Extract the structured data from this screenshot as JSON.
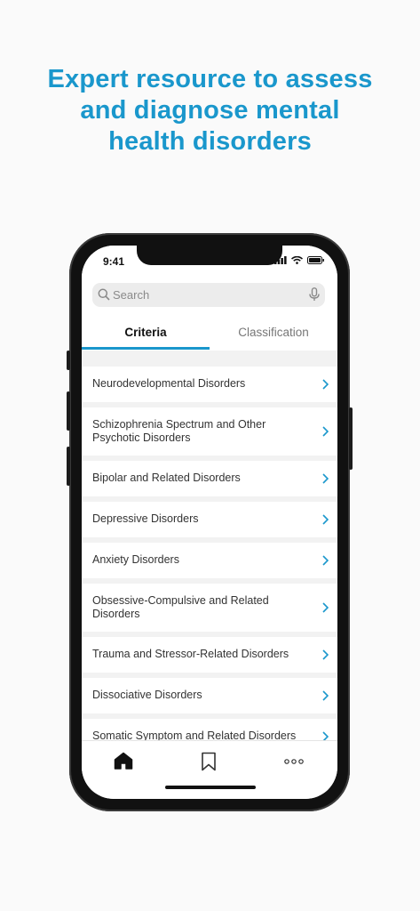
{
  "headline": {
    "line1": "Expert resource to assess",
    "line2": "and diagnose mental",
    "line3": "health disorders"
  },
  "status_bar": {
    "time": "9:41"
  },
  "search": {
    "placeholder": "Search"
  },
  "tabs": [
    {
      "label": "Criteria",
      "active": true
    },
    {
      "label": "Classification",
      "active": false
    }
  ],
  "disorders": [
    {
      "label": "Neurodevelopmental Disorders"
    },
    {
      "label": "Schizophrenia Spectrum and Other Psychotic Disorders"
    },
    {
      "label": "Bipolar and Related Disorders"
    },
    {
      "label": "Depressive Disorders"
    },
    {
      "label": "Anxiety Disorders"
    },
    {
      "label": "Obsessive-Compulsive and Related Disorders"
    },
    {
      "label": "Trauma and Stressor-Related Disorders"
    },
    {
      "label": "Dissociative Disorders"
    },
    {
      "label": "Somatic Symptom and Related Disorders"
    }
  ],
  "tabbar": {
    "items": [
      "home-icon",
      "bookmark-icon",
      "more-icon"
    ]
  },
  "colors": {
    "accent": "#1a97cc",
    "text": "#333333"
  }
}
